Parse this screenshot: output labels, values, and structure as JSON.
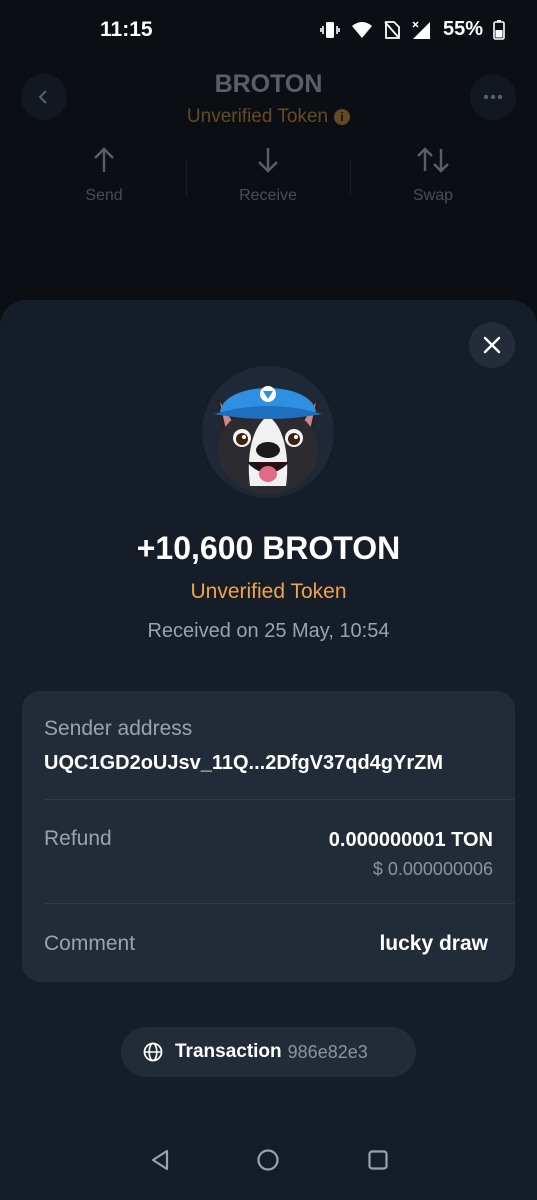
{
  "status_bar": {
    "time": "11:15",
    "battery_percent": "55%",
    "icons": [
      "vibrate-icon",
      "wifi-icon",
      "no-sim-icon",
      "signal-icon",
      "battery-icon"
    ]
  },
  "background_page": {
    "title": "BROTON",
    "subtitle": "Unverified Token",
    "actions": [
      {
        "label": "Send",
        "icon": "arrow-up-icon"
      },
      {
        "label": "Receive",
        "icon": "arrow-down-icon"
      },
      {
        "label": "Swap",
        "icon": "swap-icon"
      }
    ]
  },
  "sheet": {
    "amount": "+10,600 BROTON",
    "token_status": "Unverified Token",
    "received_text": "Received on 25 May, 10:54",
    "details": {
      "sender_label": "Sender address",
      "sender_value": "UQC1GD2oUJsv_11Q...2DfgV37qd4gYrZM",
      "refund_label": "Refund",
      "refund_value": "0.000000001 TON",
      "refund_fiat": "$ 0.000000006",
      "comment_label": "Comment",
      "comment_value": "lucky draw"
    },
    "transaction": {
      "label": "Transaction",
      "hash": "986e82e3"
    }
  },
  "colors": {
    "background": "#0b0f14",
    "sheet": "#151d28",
    "card": "#222b38",
    "warning": "#f0a34a",
    "muted_text": "#9aa3ad"
  }
}
